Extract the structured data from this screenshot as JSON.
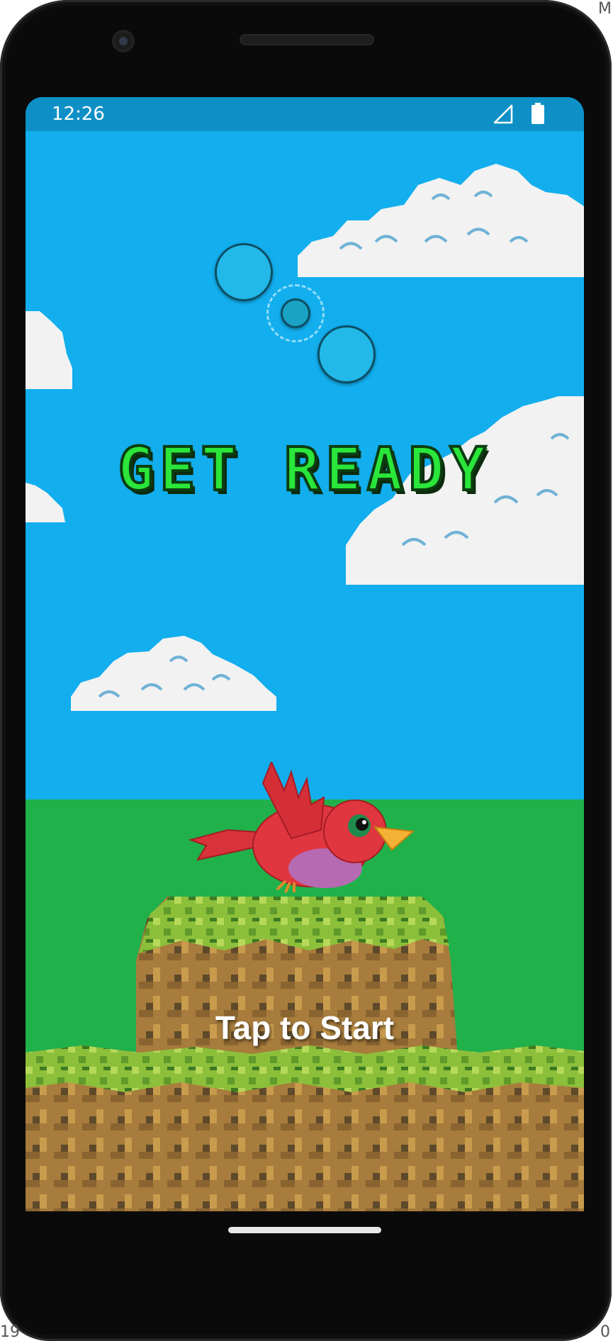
{
  "status_bar": {
    "time": "12:26",
    "icons": [
      "signal-icon",
      "battery-icon"
    ]
  },
  "game": {
    "title": "GET READY",
    "prompt": "Tap to Start",
    "sprites": [
      "bird",
      "clouds",
      "bubbles",
      "grassy-hill"
    ]
  },
  "edge_labels": {
    "top_right": "M",
    "bottom_left": "19",
    "bottom_right": "0"
  },
  "colors": {
    "sky": "#12aeee",
    "grass": "#20b14b",
    "title_fill": "#2ae63a",
    "status_bar": "#0e90c6"
  }
}
